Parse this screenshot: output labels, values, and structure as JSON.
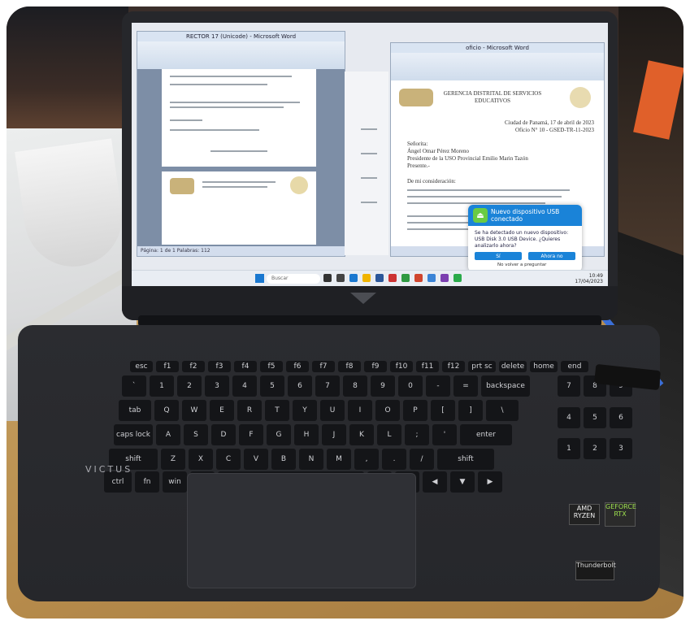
{
  "scene": {
    "laptop_brand": "VICTUS",
    "left_window": {
      "title": "RECTOR 17 (Unicode) - Microsoft Word",
      "status": "Página: 1 de 1 Palabras: 112"
    },
    "right_window": {
      "title": "oficio - Microsoft Word",
      "letterhead": "GERENCIA DISTRITAL DE SERVICIOS EDUCATIVOS",
      "letter_place_date": "Ciudad de Panamá, 17 de abril de 2023",
      "letter_ref": "Oficio N° 10 - GSED-TR-11-2023",
      "greeting_lines": [
        "Señorita:",
        "Ángel Omar Pérez Moreno",
        "Presidente de la USO Provincial Emilio Marin Tazón",
        "Presente.-"
      ],
      "body_start": "De mi consideración:"
    },
    "notification": {
      "title": "Nuevo dispositivo USB conectado",
      "message": "Se ha detectado un nuevo dispositivo: USB Disk 3.0 USB Device. ¿Quieres analizarlo ahora?",
      "button_primary": "Sí",
      "button_secondary": "Ahora no",
      "checkbox": "No volver a preguntar"
    },
    "taskbar": {
      "search_placeholder": "Buscar",
      "time": "10:49",
      "date": "17/04/2023"
    },
    "stickers": {
      "ryzen": "AMD RYZEN",
      "rtx": "GEFORCE RTX",
      "thx": "Thunderbolt"
    },
    "keyboard": {
      "row1": [
        "esc",
        "f1",
        "f2",
        "f3",
        "f4",
        "f5",
        "f6",
        "f7",
        "f8",
        "f9",
        "f10",
        "f11",
        "f12",
        "prt sc",
        "delete",
        "home",
        "end"
      ],
      "row2": [
        "`",
        "1",
        "2",
        "3",
        "4",
        "5",
        "6",
        "7",
        "8",
        "9",
        "0",
        "-",
        "=",
        "backspace"
      ],
      "row3": [
        "tab",
        "Q",
        "W",
        "E",
        "R",
        "T",
        "Y",
        "U",
        "I",
        "O",
        "P",
        "[",
        "]",
        "\\"
      ],
      "row4": [
        "caps lock",
        "A",
        "S",
        "D",
        "F",
        "G",
        "H",
        "J",
        "K",
        "L",
        ";",
        "'",
        "enter"
      ],
      "row5": [
        "shift",
        "Z",
        "X",
        "C",
        "V",
        "B",
        "N",
        "M",
        ",",
        ".",
        "/",
        "shift"
      ],
      "row6": [
        "ctrl",
        "fn",
        "win",
        "alt",
        "",
        "alt",
        "ctrl"
      ]
    }
  }
}
